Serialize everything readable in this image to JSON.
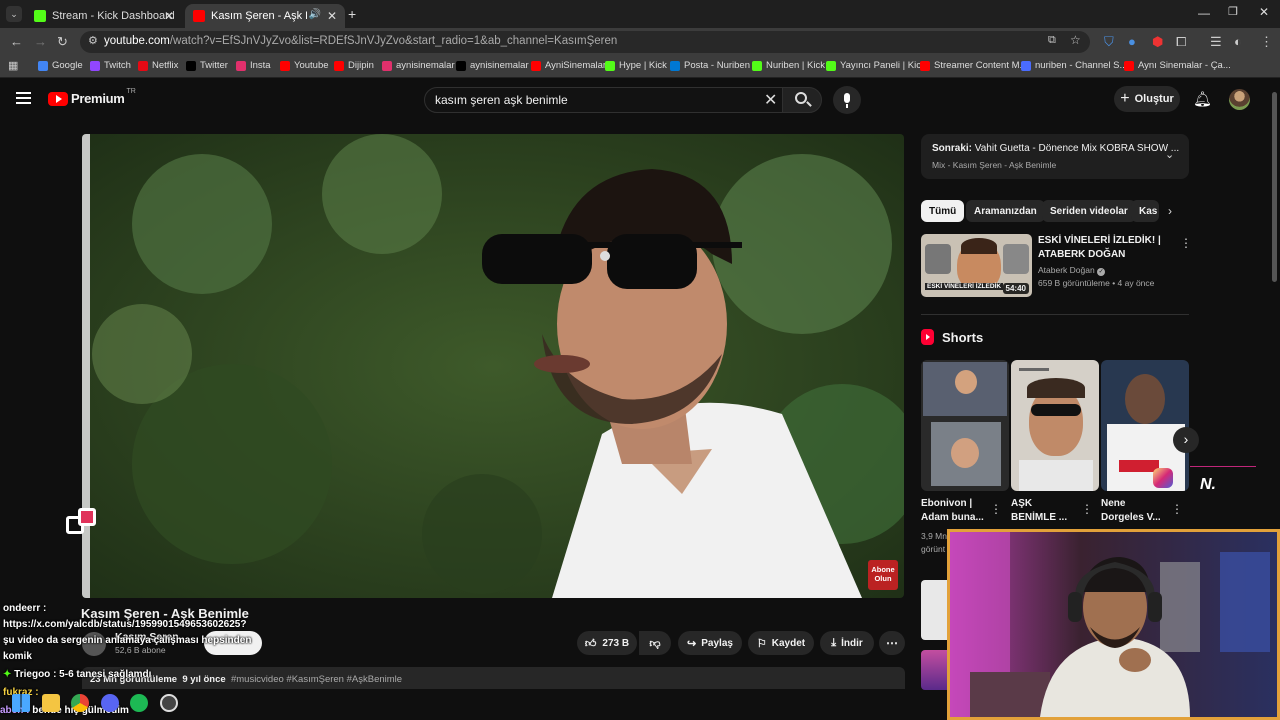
{
  "browser": {
    "tabs": [
      {
        "label": "Stream - Kick Dashboard",
        "active": false
      },
      {
        "label": "Kasım Şeren - Aşk Benimle",
        "active": true
      }
    ],
    "url_host": "youtube.com",
    "url_path": "/watch?v=EfSJnVJyZvo&list=RDEfSJnVJyZvo&start_radio=1&ab_channel=KasımŞeren",
    "bookmarks": [
      {
        "label": "Google",
        "color": "#4285f4"
      },
      {
        "label": "Twitch",
        "color": "#9146ff"
      },
      {
        "label": "Netflix",
        "color": "#e50914"
      },
      {
        "label": "Twitter",
        "color": "#000000"
      },
      {
        "label": "Insta",
        "color": "#e1306c"
      },
      {
        "label": "Youtube",
        "color": "#ff0000"
      },
      {
        "label": "Dijipin",
        "color": "#ff0000"
      },
      {
        "label": "aynisinemalar",
        "color": "#e1306c"
      },
      {
        "label": "aynisinemalar",
        "color": "#000000"
      },
      {
        "label": "AyniSinemalar",
        "color": "#ff0000"
      },
      {
        "label": "Hype | Kick",
        "color": "#53fc18"
      },
      {
        "label": "Posta - Nuriben",
        "color": "#0078d4"
      },
      {
        "label": "Nuriben | Kick",
        "color": "#53fc18"
      },
      {
        "label": "Yayıncı Paneli | Kick",
        "color": "#53fc18"
      },
      {
        "label": "Streamer Content M...",
        "color": "#ff0000"
      },
      {
        "label": "nuriben - Channel S...",
        "color": "#4a6cff"
      },
      {
        "label": "Aynı Sinemalar - Ça...",
        "color": "#ff0000"
      }
    ]
  },
  "youtube": {
    "logo_text": "Premium",
    "logo_region": "TR",
    "search_value": "kasım şeren aşk benimle",
    "create_label": "Oluştur"
  },
  "video": {
    "title": "Kasım Şeren - Aşk Benimle",
    "channel": "Kasım Şeren",
    "subscribers": "52,6 B abone",
    "likes": "273 B",
    "share_label": "Paylaş",
    "save_label": "Kaydet",
    "download_label": "İndir",
    "views": "23 Mn görüntüleme",
    "age": "9 yıl önce",
    "hashtags": "#musicvideo #KasımŞeren #AşkBenimle",
    "watermark": "Abone Olun"
  },
  "sidebar": {
    "next_prefix": "Sonraki:",
    "next_title": "Vahit Guetta - Dönence Mix KOBRA SHOW ...",
    "next_mix": "Mix - Kasım Şeren - Aşk Benimle",
    "chips": [
      "Tümü",
      "Aramanızdan",
      "Seriden videolar",
      "Kas"
    ],
    "rec": {
      "title_line1": "ESKİ VİNELERİ İZLEDİK! |",
      "title_line2": "ATABERK DOĞAN",
      "channel": "Ataberk Doğan",
      "meta": "659 B görüntüleme • 4 ay önce",
      "duration": "54:40",
      "thumb_text": "ESKİ VİNELERİ İZLEDİK"
    },
    "shorts_label": "Shorts",
    "shorts": [
      {
        "line1": "Ebonivon |",
        "line2": "Adam buna...",
        "meta1": "3,9 Mn",
        "meta2": "görünt"
      },
      {
        "line1": "AŞK",
        "line2": "BENİMLE ..."
      },
      {
        "line1": "Nene",
        "line2": "Dorgeles V..."
      }
    ]
  },
  "chat": [
    {
      "user": "ondeerr :",
      "text": ""
    },
    {
      "user": "",
      "text": "https://x.com/yalcdb/status/1959901549653602625?"
    },
    {
      "user": "",
      "text": "şu video da sergenin anlamaya çalışması hepsinden"
    },
    {
      "user": "",
      "text": "komik"
    },
    {
      "user": "Triegoo : ",
      "text": "5-6 tanesi sağlamdı"
    },
    {
      "user": "fukraz :",
      "text": ""
    },
    {
      "user": "aben :",
      "text": "bende hiç gülmedim"
    }
  ],
  "overlay_logo": "N."
}
